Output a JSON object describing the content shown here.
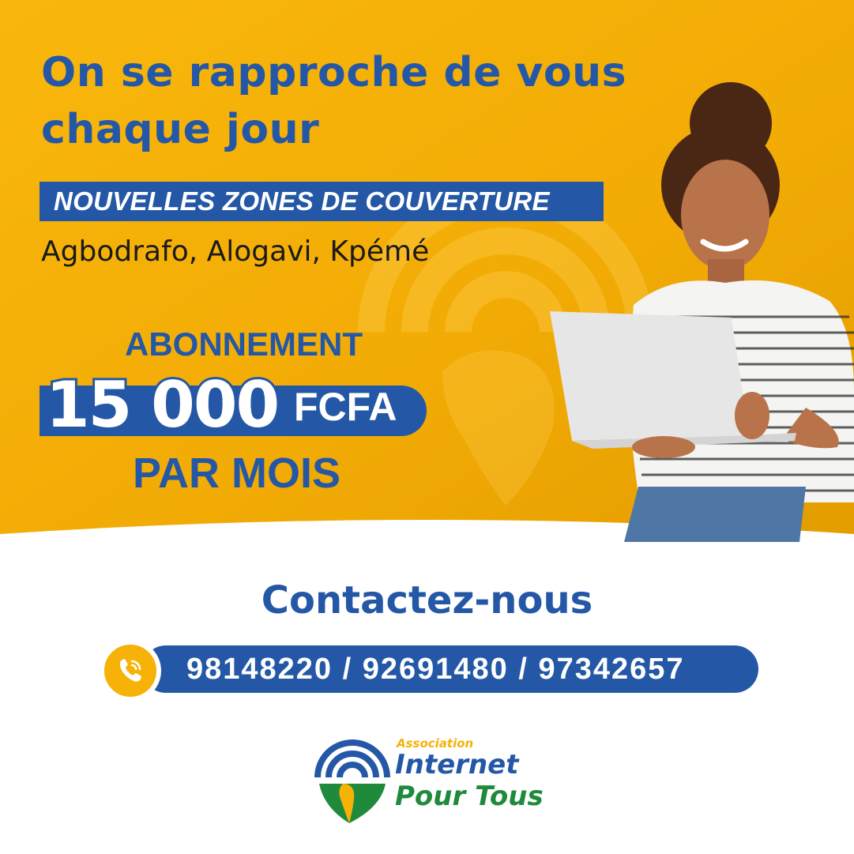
{
  "hero": {
    "headline_line1": "On se rapproche de vous",
    "headline_line2": "chaque jour",
    "coverage_banner": "NOUVELLES ZONES DE COUVERTURE",
    "coverage_zones": "Agbodrafo, Alogavi, Kpémé"
  },
  "offer": {
    "label": "ABONNEMENT",
    "amount": "15 000",
    "currency": "FCFA",
    "period": "PAR MOIS"
  },
  "contact": {
    "title": "Contactez-nous",
    "phone_icon": "phone-call-icon",
    "numbers": "98148220 / 92691480 / 97342657"
  },
  "logo": {
    "association": "Association",
    "name_line1": "Internet",
    "name_line2": "Pour Tous"
  },
  "colors": {
    "brand_blue": "#2458a6",
    "brand_yellow": "#f6b207",
    "brand_green": "#1f8a3c"
  }
}
